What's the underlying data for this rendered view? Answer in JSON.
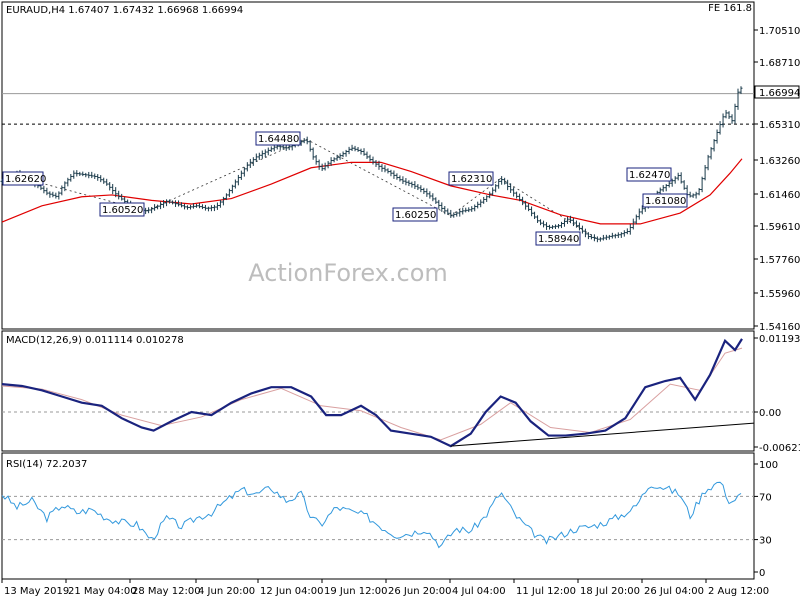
{
  "header": {
    "instrument": "EURAUD,H4",
    "ohlc": "1.67407 1.67432 1.66968 1.66994",
    "fe_label": "FE 161.8"
  },
  "watermark": "ActionForex.com",
  "colors": {
    "price": "#1a3a4a",
    "ma": "#e00000",
    "macd": "#1a237e",
    "signal": "#d9a0a0",
    "rsi": "#3399dd",
    "grid": "#9a9a9a",
    "box_border": "#1a237e"
  },
  "chart_data": [
    {
      "type": "line",
      "title": "EURAUD,H4",
      "x_ticks": [
        "13 May 2019",
        "21 May 04:00",
        "28 May 12:00",
        "4 Jun 20:00",
        "12 Jun 04:00",
        "19 Jun 12:00",
        "26 Jun 20:00",
        "4 Jul 04:00",
        "11 Jul 12:00",
        "18 Jul 20:00",
        "26 Jul 04:00",
        "2 Aug 12:00"
      ],
      "y_ticks": [
        "1.70510",
        "1.68710",
        "1.66994",
        "1.65310",
        "1.63260",
        "1.61460",
        "1.59610",
        "1.57760",
        "1.55960",
        "1.54160"
      ],
      "ylim": [
        1.5416,
        1.7151
      ],
      "current_price": 1.66994,
      "fe_level": 1.6531,
      "fe_label": "FE 161.8",
      "price_series": [
        [
          0,
          1.6215
        ],
        [
          8,
          1.624
        ],
        [
          15,
          1.6262
        ],
        [
          25,
          1.623
        ],
        [
          35,
          1.6195
        ],
        [
          45,
          1.615
        ],
        [
          55,
          1.613
        ],
        [
          62,
          1.62
        ],
        [
          72,
          1.626
        ],
        [
          85,
          1.625
        ],
        [
          95,
          1.624
        ],
        [
          105,
          1.62
        ],
        [
          115,
          1.614
        ],
        [
          125,
          1.6095
        ],
        [
          135,
          1.606
        ],
        [
          145,
          1.6052
        ],
        [
          155,
          1.6075
        ],
        [
          165,
          1.6105
        ],
        [
          175,
          1.609
        ],
        [
          185,
          1.607
        ],
        [
          195,
          1.608
        ],
        [
          205,
          1.6065
        ],
        [
          215,
          1.6075
        ],
        [
          225,
          1.614
        ],
        [
          235,
          1.622
        ],
        [
          245,
          1.63
        ],
        [
          255,
          1.635
        ],
        [
          265,
          1.638
        ],
        [
          275,
          1.641
        ],
        [
          285,
          1.64
        ],
        [
          295,
          1.642
        ],
        [
          305,
          1.6448
        ],
        [
          312,
          1.635
        ],
        [
          320,
          1.628
        ],
        [
          330,
          1.633
        ],
        [
          340,
          1.636
        ],
        [
          350,
          1.64
        ],
        [
          360,
          1.638
        ],
        [
          370,
          1.633
        ],
        [
          380,
          1.629
        ],
        [
          390,
          1.626
        ],
        [
          400,
          1.622
        ],
        [
          410,
          1.62
        ],
        [
          420,
          1.617
        ],
        [
          430,
          1.613
        ],
        [
          440,
          1.607
        ],
        [
          450,
          1.6025
        ],
        [
          460,
          1.605
        ],
        [
          470,
          1.606
        ],
        [
          480,
          1.61
        ],
        [
          490,
          1.615
        ],
        [
          500,
          1.6231
        ],
        [
          508,
          1.618
        ],
        [
          518,
          1.612
        ],
        [
          528,
          1.606
        ],
        [
          538,
          1.599
        ],
        [
          548,
          1.596
        ],
        [
          558,
          1.597
        ],
        [
          568,
          1.601
        ],
        [
          578,
          1.596
        ],
        [
          588,
          1.591
        ],
        [
          598,
          1.5894
        ],
        [
          608,
          1.591
        ],
        [
          618,
          1.592
        ],
        [
          628,
          1.594
        ],
        [
          638,
          1.604
        ],
        [
          648,
          1.61
        ],
        [
          658,
          1.616
        ],
        [
          668,
          1.62
        ],
        [
          678,
          1.6247
        ],
        [
          688,
          1.613
        ],
        [
          698,
          1.615
        ],
        [
          708,
          1.635
        ],
        [
          718,
          1.65
        ],
        [
          725,
          1.66
        ],
        [
          732,
          1.655
        ],
        [
          740,
          1.676
        ],
        [
          742,
          1.6699
        ]
      ],
      "ma_series": [
        [
          0,
          1.599
        ],
        [
          40,
          1.608
        ],
        [
          80,
          1.613
        ],
        [
          110,
          1.614
        ],
        [
          150,
          1.611
        ],
        [
          190,
          1.609
        ],
        [
          230,
          1.612
        ],
        [
          270,
          1.62
        ],
        [
          310,
          1.629
        ],
        [
          350,
          1.632
        ],
        [
          380,
          1.632
        ],
        [
          410,
          1.627
        ],
        [
          450,
          1.619
        ],
        [
          490,
          1.614
        ],
        [
          520,
          1.611
        ],
        [
          560,
          1.603
        ],
        [
          600,
          1.598
        ],
        [
          640,
          1.598
        ],
        [
          680,
          1.604
        ],
        [
          710,
          1.614
        ],
        [
          730,
          1.626
        ],
        [
          742,
          1.634
        ]
      ],
      "annotations": [
        {
          "text": "1.62620"
        },
        {
          "text": "1.60520"
        },
        {
          "text": "1.64480"
        },
        {
          "text": "1.60250"
        },
        {
          "text": "1.62310"
        },
        {
          "text": "1.58940"
        },
        {
          "text": "1.62470"
        },
        {
          "text": "1.61080"
        }
      ]
    },
    {
      "type": "line",
      "title": "MACD(12,26,9) 0.011114 0.010278",
      "y_ticks": [
        "0.011939",
        "0.00",
        "-0.00621"
      ],
      "ylim": [
        -0.00621,
        0.011939
      ],
      "macd_series": [
        [
          0,
          0.0045
        ],
        [
          20,
          0.0042
        ],
        [
          40,
          0.0035
        ],
        [
          60,
          0.0025
        ],
        [
          80,
          0.0015
        ],
        [
          100,
          0.001
        ],
        [
          120,
          -0.001
        ],
        [
          140,
          -0.0025
        ],
        [
          152,
          -0.003
        ],
        [
          170,
          -0.0015
        ],
        [
          190,
          0.0
        ],
        [
          210,
          -0.0005
        ],
        [
          230,
          0.0015
        ],
        [
          250,
          0.003
        ],
        [
          270,
          0.004
        ],
        [
          290,
          0.004
        ],
        [
          310,
          0.0025
        ],
        [
          325,
          -0.0005
        ],
        [
          340,
          -0.0005
        ],
        [
          360,
          0.001
        ],
        [
          375,
          -0.0005
        ],
        [
          390,
          -0.003
        ],
        [
          410,
          -0.0035
        ],
        [
          430,
          -0.004
        ],
        [
          450,
          -0.0055
        ],
        [
          470,
          -0.0035
        ],
        [
          485,
          0.0
        ],
        [
          500,
          0.0025
        ],
        [
          515,
          0.0015
        ],
        [
          530,
          -0.0015
        ],
        [
          548,
          -0.0038
        ],
        [
          565,
          -0.0038
        ],
        [
          585,
          -0.0035
        ],
        [
          605,
          -0.003
        ],
        [
          625,
          -0.001
        ],
        [
          645,
          0.004
        ],
        [
          665,
          0.005
        ],
        [
          680,
          0.0055
        ],
        [
          695,
          0.002
        ],
        [
          710,
          0.006
        ],
        [
          725,
          0.0115
        ],
        [
          735,
          0.01
        ],
        [
          742,
          0.0118
        ]
      ],
      "signal_series": [
        [
          0,
          0.0042
        ],
        [
          40,
          0.0037
        ],
        [
          80,
          0.002
        ],
        [
          120,
          -0.0005
        ],
        [
          160,
          -0.0022
        ],
        [
          200,
          -0.0008
        ],
        [
          240,
          0.002
        ],
        [
          280,
          0.0038
        ],
        [
          320,
          0.001
        ],
        [
          360,
          0.0002
        ],
        [
          400,
          -0.0025
        ],
        [
          440,
          -0.0045
        ],
        [
          480,
          -0.002
        ],
        [
          510,
          0.0015
        ],
        [
          550,
          -0.0025
        ],
        [
          590,
          -0.0033
        ],
        [
          630,
          -0.0012
        ],
        [
          670,
          0.0045
        ],
        [
          700,
          0.0035
        ],
        [
          725,
          0.0095
        ],
        [
          742,
          0.0103
        ]
      ],
      "trendline": [
        [
          450,
          -0.0055
        ],
        [
          755,
          -0.0018
        ]
      ]
    },
    {
      "type": "line",
      "title": "RSI(14) 72.2037",
      "y_ticks": [
        "100",
        "70",
        "30",
        "0"
      ],
      "ylim": [
        0,
        100
      ],
      "levels": [
        70,
        30
      ],
      "rsi_series": [
        [
          0,
          72
        ],
        [
          15,
          60
        ],
        [
          30,
          66
        ],
        [
          45,
          50
        ],
        [
          60,
          62
        ],
        [
          75,
          55
        ],
        [
          90,
          58
        ],
        [
          105,
          50
        ],
        [
          120,
          46
        ],
        [
          135,
          44
        ],
        [
          150,
          30
        ],
        [
          165,
          50
        ],
        [
          180,
          42
        ],
        [
          195,
          50
        ],
        [
          210,
          55
        ],
        [
          225,
          66
        ],
        [
          240,
          76
        ],
        [
          255,
          72
        ],
        [
          270,
          78
        ],
        [
          285,
          66
        ],
        [
          300,
          72
        ],
        [
          310,
          50
        ],
        [
          320,
          44
        ],
        [
          335,
          60
        ],
        [
          350,
          56
        ],
        [
          365,
          52
        ],
        [
          380,
          42
        ],
        [
          395,
          34
        ],
        [
          410,
          36
        ],
        [
          425,
          40
        ],
        [
          440,
          24
        ],
        [
          455,
          40
        ],
        [
          470,
          38
        ],
        [
          485,
          52
        ],
        [
          500,
          74
        ],
        [
          515,
          52
        ],
        [
          530,
          38
        ],
        [
          545,
          28
        ],
        [
          560,
          34
        ],
        [
          575,
          40
        ],
        [
          590,
          42
        ],
        [
          605,
          46
        ],
        [
          620,
          52
        ],
        [
          635,
          60
        ],
        [
          650,
          82
        ],
        [
          665,
          78
        ],
        [
          680,
          72
        ],
        [
          690,
          52
        ],
        [
          705,
          76
        ],
        [
          720,
          84
        ],
        [
          730,
          64
        ],
        [
          742,
          72
        ]
      ]
    }
  ]
}
